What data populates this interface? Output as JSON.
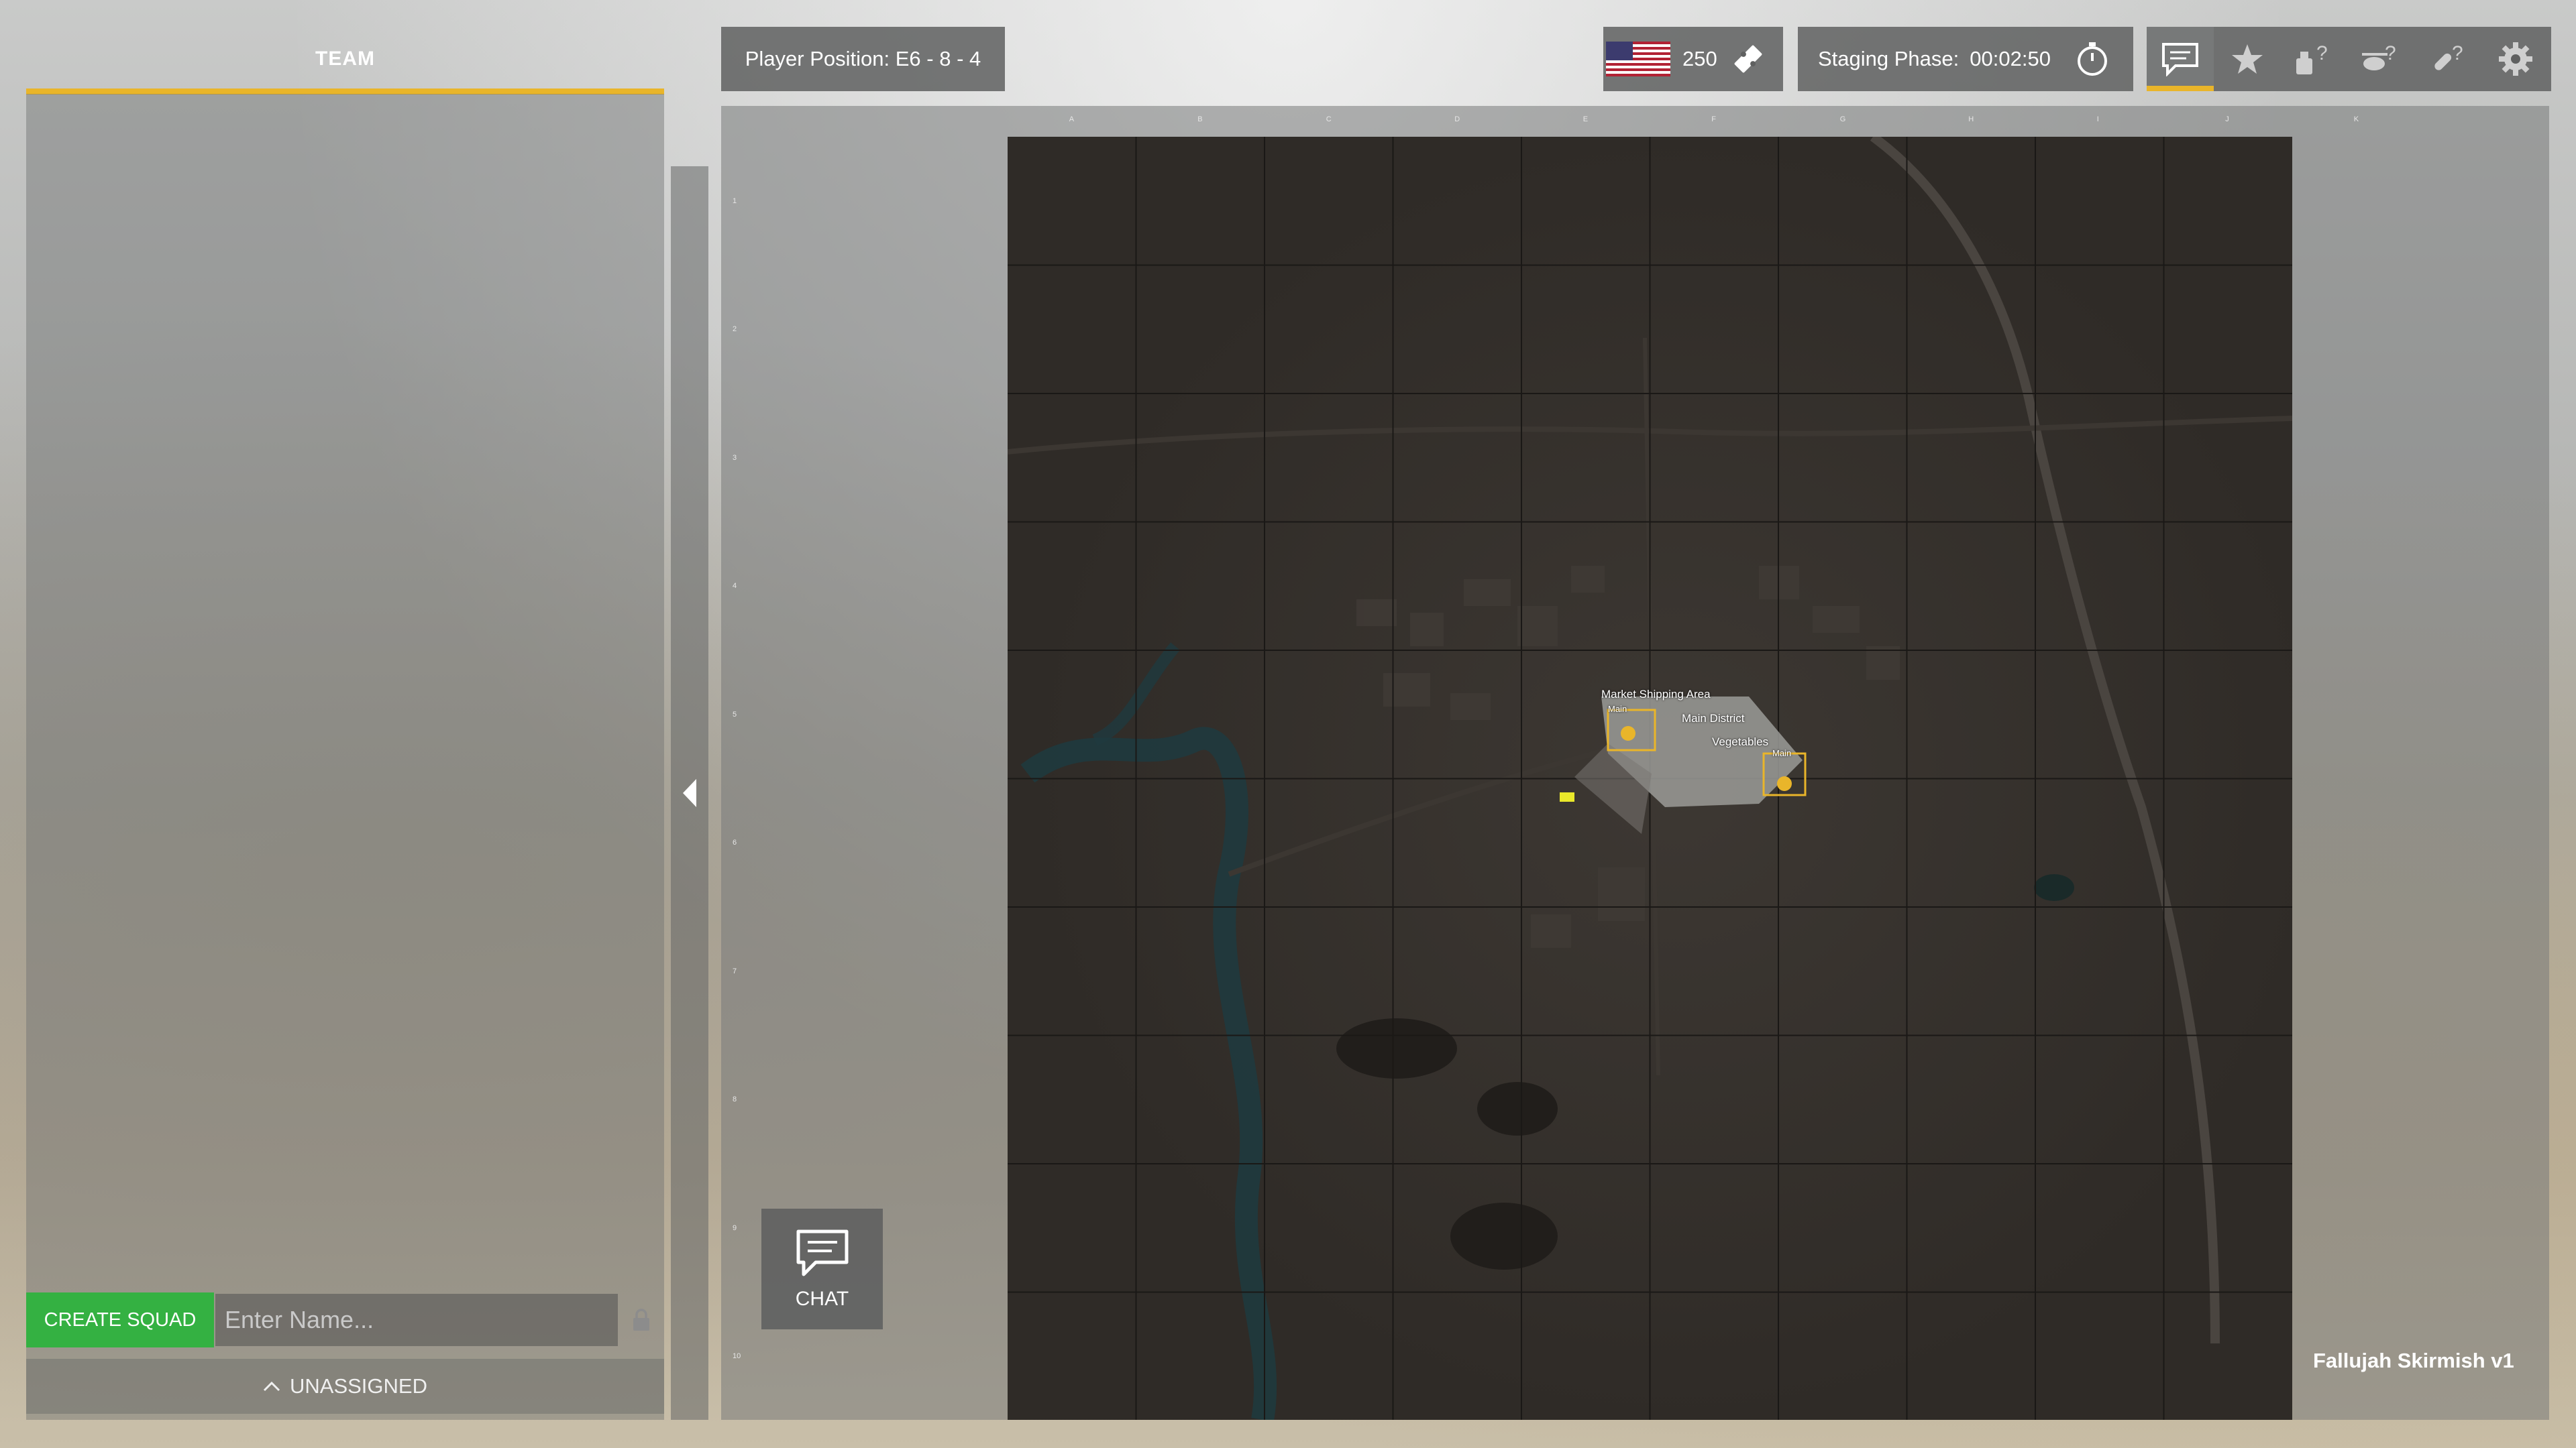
{
  "team_panel": {
    "tab_label": "TEAM",
    "create_squad_label": "CREATE SQUAD",
    "name_placeholder": "Enter Name...",
    "unassigned_label": "UNASSIGNED"
  },
  "top_bar": {
    "player_position": "Player Position: E6 - 8 - 4",
    "tickets": "250",
    "staging_label": "Staging Phase:",
    "staging_time": "00:02:50",
    "toolbar_icons": [
      "chat-icon",
      "star-icon",
      "tank-help-icon",
      "helicopter-help-icon",
      "rocket-help-icon",
      "gear-icon"
    ],
    "active_icon": "chat-icon"
  },
  "map": {
    "columns": [
      "A",
      "B",
      "C",
      "D",
      "E",
      "F",
      "G",
      "H",
      "I",
      "J",
      "K"
    ],
    "rows": [
      "1",
      "2",
      "3",
      "4",
      "5",
      "6",
      "7",
      "8",
      "9",
      "10"
    ],
    "map_name": "Fallujah Skirmish v1",
    "labels": {
      "market_shipping": "Market Shipping Area",
      "main_district": "Main District",
      "vegetables": "Vegetables",
      "main_tag_1": "Main",
      "main_tag_2": "Main"
    }
  },
  "chat_button": {
    "label": "CHAT"
  },
  "colors": {
    "accent": "#e9b52a",
    "create_green": "#34b142",
    "panel_gray": "#5f6060",
    "map_dark": "#2f2b27"
  }
}
